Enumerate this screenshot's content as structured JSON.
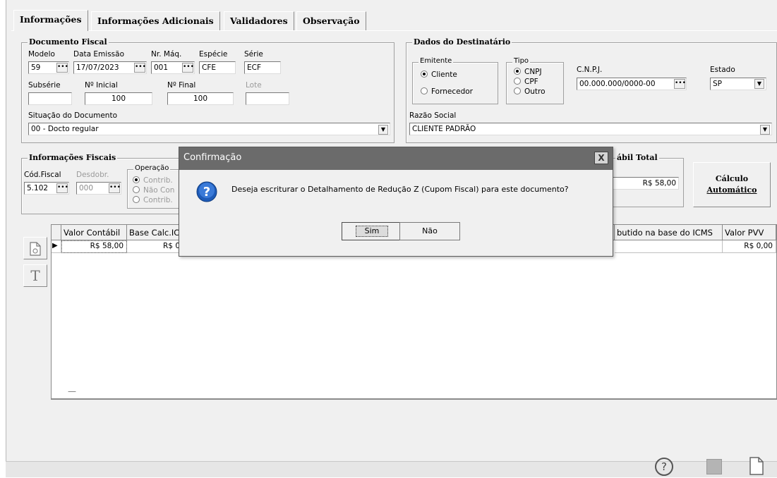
{
  "tabs": [
    "Informações",
    "Informações Adicionais",
    "Validadores",
    "Observação"
  ],
  "doc_fiscal": {
    "title": "Documento Fiscal",
    "modelo_label": "Modelo",
    "modelo_value": "59",
    "data_label": "Data Emissão",
    "data_value": "17/07/2023",
    "nrmaq_label": "Nr. Máq.",
    "nrmaq_value": "001",
    "especie_label": "Espécie",
    "especie_value": "CFE",
    "serie_label": "Série",
    "serie_value": "ECF",
    "subserie_label": "Subsérie",
    "subserie_value": "",
    "ninicial_label": "Nº Inicial",
    "ninicial_value": "100",
    "nfinal_label": "Nº Final",
    "nfinal_value": "100",
    "lote_label": "Lote",
    "lote_value": "",
    "situacao_label": "Situação do Documento",
    "situacao_value": "00 - Docto regular"
  },
  "destinatario": {
    "title": "Dados do Destinatário",
    "emitente_label": "Emitente",
    "emitente_options": [
      "Cliente",
      "Fornecedor"
    ],
    "tipo_label": "Tipo",
    "tipo_options": [
      "CNPJ",
      "CPF",
      "Outro"
    ],
    "cnpj_label": "C.N.P.J.",
    "cnpj_value": "00.000.000/0000-00",
    "estado_label": "Estado",
    "estado_value": "SP",
    "razao_label": "Razão Social",
    "razao_value": "CLIENTE PADRÃO"
  },
  "info_fiscais": {
    "title": "Informações Fiscais",
    "codfiscal_label": "Cód.Fiscal",
    "codfiscal_value": "5.102",
    "desdobr_label": "Desdobr.",
    "desdobr_value": "000",
    "operacao_label": "Operação",
    "operacao_options": [
      "Contrib.",
      "Não Con",
      "Contrib."
    ]
  },
  "contabil": {
    "title": "ábil Total",
    "value": "R$ 58,00"
  },
  "calc_button": {
    "line1": "Cálculo",
    "line2": "Automático"
  },
  "grid": {
    "headers": [
      "Valor Contábil",
      "Base Calc.IC",
      "butido na base do ICMS",
      "Valor PVV"
    ],
    "row": [
      "R$ 58,00",
      "R$ 0",
      "",
      "R$ 0,00"
    ],
    "footer": "—"
  },
  "dialog": {
    "title": "Confirmação",
    "close": "X",
    "message": "Deseja escriturar o Detalhamento de Redução Z (Cupom Fiscal) para este documento?",
    "yes": "Sim",
    "no": "Não"
  },
  "side_buttons": [
    "T"
  ],
  "colors": {
    "dialog_title_bg": "#6b6b6b",
    "question_icon": "#1e5bb8"
  }
}
